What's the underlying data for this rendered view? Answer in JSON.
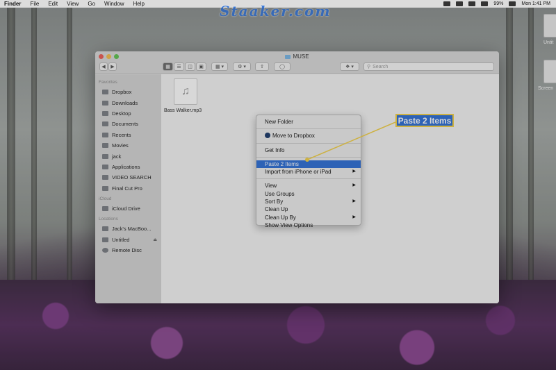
{
  "watermark": "Staaker.com",
  "menubar": {
    "app": "Finder",
    "menus": [
      "File",
      "Edit",
      "View",
      "Go",
      "Window",
      "Help"
    ],
    "battery": "99%",
    "clock": "Mon 1:41 PM"
  },
  "desktop": {
    "icons": [
      {
        "label": "Untit"
      },
      {
        "label": "Screen"
      }
    ]
  },
  "window": {
    "title": "MUSE",
    "search_placeholder": "Search",
    "sidebar": {
      "favorites_heading": "Favorites",
      "favorites": [
        {
          "label": "Dropbox",
          "icon": "dropbox-icon"
        },
        {
          "label": "Downloads",
          "icon": "downloads-icon"
        },
        {
          "label": "Desktop",
          "icon": "desktop-icon"
        },
        {
          "label": "Documents",
          "icon": "documents-icon"
        },
        {
          "label": "Recents",
          "icon": "recents-icon"
        },
        {
          "label": "Movies",
          "icon": "movies-icon"
        },
        {
          "label": "jack",
          "icon": "home-icon"
        },
        {
          "label": "Applications",
          "icon": "applications-icon"
        },
        {
          "label": "VIDEO SEARCH",
          "icon": "gear-icon"
        },
        {
          "label": "Final Cut Pro",
          "icon": "final-cut-icon"
        }
      ],
      "icloud_heading": "iCloud",
      "icloud": [
        {
          "label": "iCloud Drive",
          "icon": "cloud-icon"
        }
      ],
      "locations_heading": "Locations",
      "locations": [
        {
          "label": "Jack's MacBoo...",
          "icon": "laptop-icon"
        },
        {
          "label": "Untitled",
          "icon": "disk-icon"
        },
        {
          "label": "Remote Disc",
          "icon": "disc-icon"
        }
      ]
    },
    "files": [
      {
        "name": "Bass Walker.mp3",
        "icon": "music-file-icon"
      }
    ]
  },
  "context_menu": {
    "items": [
      {
        "label": "New Folder"
      },
      {
        "label": "Move to Dropbox"
      },
      {
        "label": "Get Info"
      },
      {
        "label": "Paste 2 Items"
      },
      {
        "label": "Import from iPhone or iPad"
      },
      {
        "label": "View"
      },
      {
        "label": "Use Groups"
      },
      {
        "label": "Sort By"
      },
      {
        "label": "Clean Up"
      },
      {
        "label": "Clean Up By"
      },
      {
        "label": "Show View Options"
      }
    ]
  },
  "callout": {
    "label": "Paste 2 Items",
    "color": "#2f6fd6",
    "border_color": "#f2d048"
  }
}
